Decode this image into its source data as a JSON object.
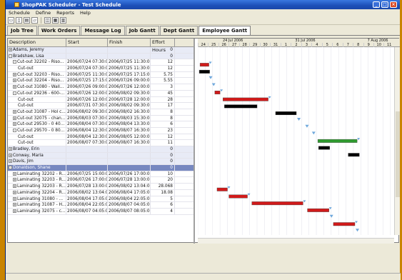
{
  "window": {
    "title": "ShopPAK Scheduler - Test Schedule"
  },
  "menu": [
    "Schedule",
    "Define",
    "Reports",
    "Help"
  ],
  "tabs": [
    "Job Tree",
    "Work Orders",
    "Message Log",
    "Job Gantt",
    "Dept Gantt",
    "Employee Gantt"
  ],
  "active_tab": 5,
  "columns": {
    "description": "Description",
    "start": "Start",
    "finish": "Finish",
    "effort": "Effort Hours"
  },
  "rows": [
    {
      "type": "group",
      "desc": "Adams, Jeremy",
      "start": "",
      "finish": "",
      "effort": "0",
      "exp": "+"
    },
    {
      "type": "group",
      "desc": "Bradshaw, Lisa",
      "start": "",
      "finish": "",
      "effort": "0",
      "exp": "-"
    },
    {
      "type": "task",
      "desc": "Cut-out  32202 - Riso...",
      "start": "2006/07/24 07:30:00",
      "finish": "2006/07/25 11:30:00",
      "effort": "12",
      "exp": "-"
    },
    {
      "type": "sub",
      "desc": "Cut-out",
      "start": "2006/07/24 07:30:00",
      "finish": "2006/07/25 11:30:00",
      "effort": "12"
    },
    {
      "type": "task",
      "desc": "Cut-out  32203 - Riso...",
      "start": "2006/07/25 11:30:00",
      "finish": "2006/07/25 17:15:00",
      "effort": "5.75",
      "exp": "+"
    },
    {
      "type": "task",
      "desc": "Cut-out  32204 - Riso...",
      "start": "2006/07/25 17:15:00",
      "finish": "2006/07/26 09:00:00",
      "effort": "5.55",
      "exp": "+"
    },
    {
      "type": "task",
      "desc": "Cut-out  31080 - Wall...",
      "start": "2006/07/26 09:00:00",
      "finish": "2006/07/26 12:00:00",
      "effort": "3",
      "exp": "+"
    },
    {
      "type": "task",
      "desc": "Cut-out  29236 - 600-...",
      "start": "2006/07/26 12:00:00",
      "finish": "2006/08/02 09:30:00",
      "effort": "45",
      "exp": "-"
    },
    {
      "type": "sub",
      "desc": "Cut-out",
      "start": "2006/07/26 12:00:00",
      "finish": "2006/07/28 12:00:00",
      "effort": "28"
    },
    {
      "type": "sub",
      "desc": "Cut-out",
      "start": "2006/07/31 07:30:00",
      "finish": "2006/08/02 09:30:00",
      "effort": "17"
    },
    {
      "type": "task",
      "desc": "Cut-out  31087 - Hol c...",
      "start": "2006/08/02 09:30:00",
      "finish": "2006/08/02 16:30:00",
      "effort": "8",
      "exp": "+"
    },
    {
      "type": "task",
      "desc": "Cut-out  32075 - chan...",
      "start": "2006/08/03 07:30:00",
      "finish": "2006/08/03 15:30:00",
      "effort": "8",
      "exp": "+"
    },
    {
      "type": "task",
      "desc": "Cut-out  29530 - 0 40...",
      "start": "2006/08/04 07:30:00",
      "finish": "2006/08/04 13:30:00",
      "effort": "6",
      "exp": "+"
    },
    {
      "type": "task",
      "desc": "Cut-out  29570 - 0 80...",
      "start": "2006/08/04 12:30:00",
      "finish": "2006/08/07 16:30:00",
      "effort": "23",
      "exp": "-"
    },
    {
      "type": "sub",
      "desc": "Cut-out",
      "start": "2006/08/04 12:30:00",
      "finish": "2006/08/05 12:00:00",
      "effort": "12"
    },
    {
      "type": "sub",
      "desc": "Cut-out",
      "start": "2006/08/07 07:30:00",
      "finish": "2006/08/07 16:30:00",
      "effort": "11"
    },
    {
      "type": "group",
      "desc": "Bradley, Erin",
      "start": "",
      "finish": "",
      "effort": "0",
      "exp": "+"
    },
    {
      "type": "group",
      "desc": "Conway, Maria",
      "start": "",
      "finish": "",
      "effort": "0",
      "exp": "+"
    },
    {
      "type": "group",
      "desc": "Davis, Jim",
      "start": "",
      "finish": "",
      "effort": "0",
      "exp": "+"
    },
    {
      "type": "hl",
      "desc": "Donaldson, Shane",
      "start": "",
      "finish": "",
      "effort": "0",
      "exp": "-"
    },
    {
      "type": "task",
      "desc": "Laminating  32202 - R...",
      "start": "2006/07/25 15:00:00",
      "finish": "2006/07/26 17:00:00",
      "effort": "10",
      "exp": "+"
    },
    {
      "type": "task",
      "desc": "Laminating  32203 - R...",
      "start": "2006/07/26 17:00:00",
      "finish": "2006/07/28 13:00:00",
      "effort": "20",
      "exp": "+"
    },
    {
      "type": "task",
      "desc": "Laminating  32203 - R...",
      "start": "2006/07/28 13:00:00",
      "finish": "2006/08/02 13:04:00",
      "effort": "28.068",
      "exp": "+"
    },
    {
      "type": "task",
      "desc": "Laminating  32204 - R...",
      "start": "2006/08/02 13:04:00",
      "finish": "2006/08/04 17:05:00",
      "effort": "18.08",
      "exp": "+"
    },
    {
      "type": "task",
      "desc": "Laminating  31080 - ...",
      "start": "2006/08/04 17:05:00",
      "finish": "2006/08/04 22:05:00",
      "effort": "5",
      "exp": "+"
    },
    {
      "type": "task",
      "desc": "Laminating  31087 - H...",
      "start": "2006/08/04 22:05:00",
      "finish": "2006/08/07 04:05:00",
      "effort": "6",
      "exp": "+"
    },
    {
      "type": "task",
      "desc": "Laminating  32075 - c...",
      "start": "2006/08/07 04:05:00",
      "finish": "2006/08/07 08:05:00",
      "effort": "4",
      "exp": "+"
    }
  ],
  "gantt": {
    "weeks": [
      "24 Jul 2006",
      "31 Jul 2006",
      "7 Aug 2006"
    ],
    "days": [
      "24",
      "25",
      "26",
      "27",
      "28",
      "29",
      "30",
      "31",
      "1",
      "2",
      "3",
      "4",
      "5",
      "6",
      "7",
      "8",
      "9",
      "10",
      "11"
    ],
    "colors": {
      "task": "#d11a1a",
      "sub": "#000000",
      "highlight": "#2f9b2f",
      "marker": "#6fa8dc"
    }
  },
  "chart_data": {
    "type": "gantt",
    "bars": [
      {
        "row": 2,
        "start": 0.3,
        "end": 1.5,
        "kind": "task"
      },
      {
        "row": 3,
        "start": 0.2,
        "end": 1.6,
        "kind": "sub"
      },
      {
        "row": 4,
        "start": 1.5,
        "end": 1.9,
        "kind": "marker"
      },
      {
        "row": 5,
        "start": 1.9,
        "end": 2.3,
        "kind": "marker"
      },
      {
        "row": 6,
        "start": 2.3,
        "end": 3.0,
        "kind": "task"
      },
      {
        "row": 7,
        "start": 3.4,
        "end": 9.5,
        "kind": "task"
      },
      {
        "row": 8,
        "start": 3.6,
        "end": 8.0,
        "kind": "sub"
      },
      {
        "row": 9,
        "start": 10.5,
        "end": 13.3,
        "kind": "sub"
      },
      {
        "row": 10,
        "start": 13.4,
        "end": 14.0,
        "kind": "marker"
      },
      {
        "row": 11,
        "start": 14.5,
        "end": 15.2,
        "kind": "marker"
      },
      {
        "row": 12,
        "start": 15.4,
        "end": 16.1,
        "kind": "marker"
      },
      {
        "row": 13,
        "start": 16.2,
        "end": 21.5,
        "kind": "highlight"
      },
      {
        "row": 14,
        "start": 16.3,
        "end": 17.8,
        "kind": "sub"
      },
      {
        "row": 15,
        "start": 20.3,
        "end": 21.8,
        "kind": "sub"
      },
      {
        "row": 20,
        "start": 2.6,
        "end": 4.0,
        "kind": "task"
      },
      {
        "row": 21,
        "start": 4.2,
        "end": 6.7,
        "kind": "task"
      },
      {
        "row": 22,
        "start": 7.3,
        "end": 14.2,
        "kind": "task"
      },
      {
        "row": 23,
        "start": 14.8,
        "end": 17.7,
        "kind": "task"
      },
      {
        "row": 24,
        "start": 17.8,
        "end": 18.3,
        "kind": "marker"
      },
      {
        "row": 25,
        "start": 18.3,
        "end": 21.2,
        "kind": "task"
      },
      {
        "row": 26,
        "start": 21.3,
        "end": 21.8,
        "kind": "marker"
      }
    ]
  }
}
